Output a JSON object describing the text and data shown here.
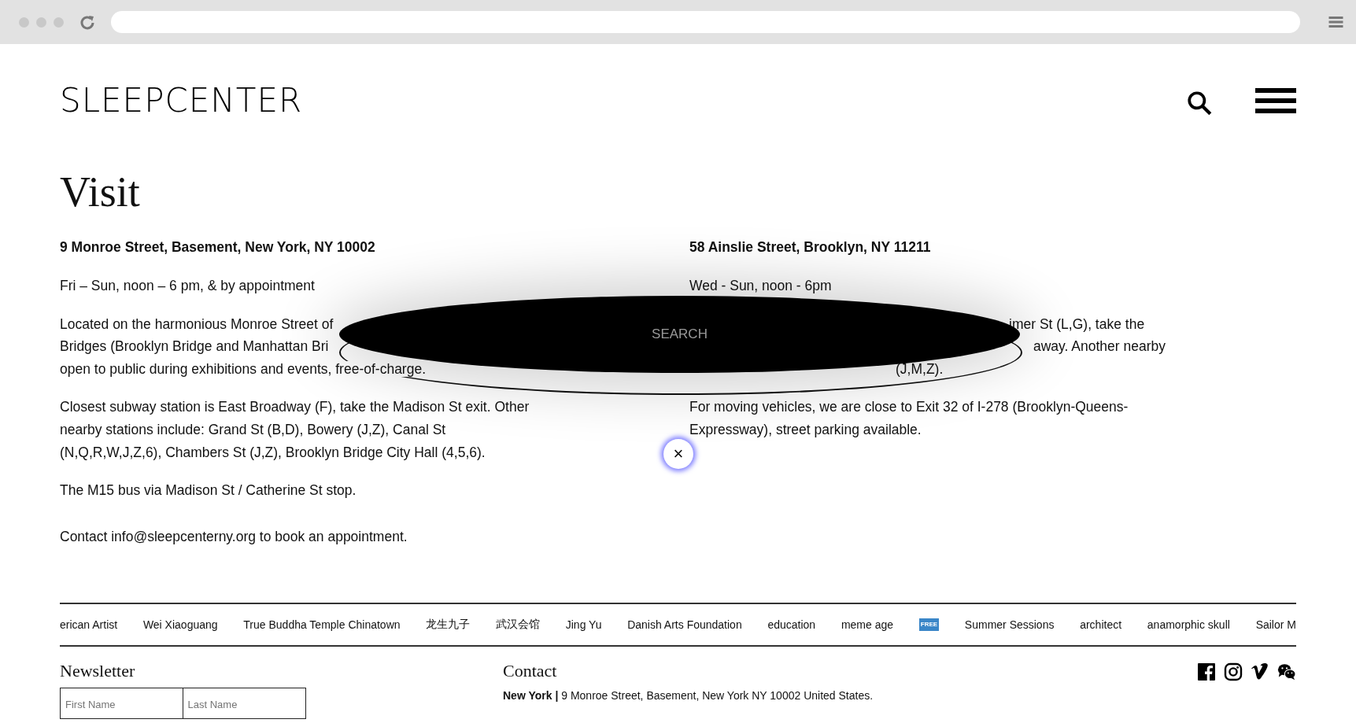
{
  "logo": "SLEEPCENTER",
  "title": "Visit",
  "columns": [
    [
      {
        "kind": "address",
        "text": "9 Monroe Street, Basement, New York, NY 10002"
      },
      {
        "kind": "para",
        "text": "Fri – Sun, noon – 6 pm, & by appointment"
      },
      {
        "kind": "lines",
        "lines": [
          {
            "kind": "head",
            "text": "Located on the harmonious Monroe Street of"
          },
          {
            "kind": "head",
            "text": "Bridges (Brooklyn Bridge and Manhattan Bri"
          },
          {
            "kind": "full",
            "text": "open to public during exhibitions and events, free-of-charge."
          }
        ]
      },
      {
        "kind": "para",
        "text": "Closest subway station is East Broadway (F), take the Madison St exit. Other nearby stations include: Grand St (B,D), Bowery (J,Z), Canal St (N,Q,R,W,J,Z,6), Chambers St (J,Z), Brooklyn Bridge City Hall (4,5,6)."
      },
      {
        "kind": "para",
        "text": "The M15 bus via Madison St / Catherine St stop."
      },
      {
        "kind": "contact",
        "text": "Contact info@sleepcenterny.org to book an appointment."
      }
    ],
    [
      {
        "kind": "address",
        "text": "58 Ainslie Street, Brooklyn, NY 11211"
      },
      {
        "kind": "para",
        "text": "Wed - Sun, noon - 6pm"
      },
      {
        "kind": "lines",
        "lines": [
          {
            "kind": "tail",
            "text": "imer St (L,G), take the"
          },
          {
            "kind": "tail-far",
            "text": "away. Another nearby"
          },
          {
            "kind": "tail-mid",
            "text": "(J,M,Z)."
          }
        ]
      },
      {
        "kind": "para",
        "text": "For moving vehicles, we are close to Exit 32 of I-278 (Brooklyn-Queens-Expressway), street parking available."
      }
    ]
  ],
  "search": {
    "placeholder": "SEARCH",
    "close": "×"
  },
  "tags": [
    {
      "kind": "text",
      "text": "erican Artist"
    },
    {
      "kind": "text",
      "text": "Wei Xiaoguang"
    },
    {
      "kind": "text",
      "text": "True Buddha Temple Chinatown"
    },
    {
      "kind": "text",
      "text": "龙生九子"
    },
    {
      "kind": "text",
      "text": "武汉会馆"
    },
    {
      "kind": "text",
      "text": "Jing Yu"
    },
    {
      "kind": "text",
      "text": "Danish Arts Foundation"
    },
    {
      "kind": "text",
      "text": "education"
    },
    {
      "kind": "text",
      "text": "meme age"
    },
    {
      "kind": "badge",
      "text": "FREE"
    },
    {
      "kind": "text",
      "text": "Summer Sessions"
    },
    {
      "kind": "text",
      "text": "architect"
    },
    {
      "kind": "text",
      "text": "anamorphic skull"
    },
    {
      "kind": "text",
      "text": "Sailor M"
    }
  ],
  "newsletter": {
    "title": "Newsletter",
    "fields": [
      {
        "placeholder": "First Name"
      },
      {
        "placeholder": "Last Name"
      }
    ]
  },
  "contact": {
    "title": "Contact",
    "address": "**New York |** 9 Monroe Street, Basement, New York NY 10002 United States."
  }
}
